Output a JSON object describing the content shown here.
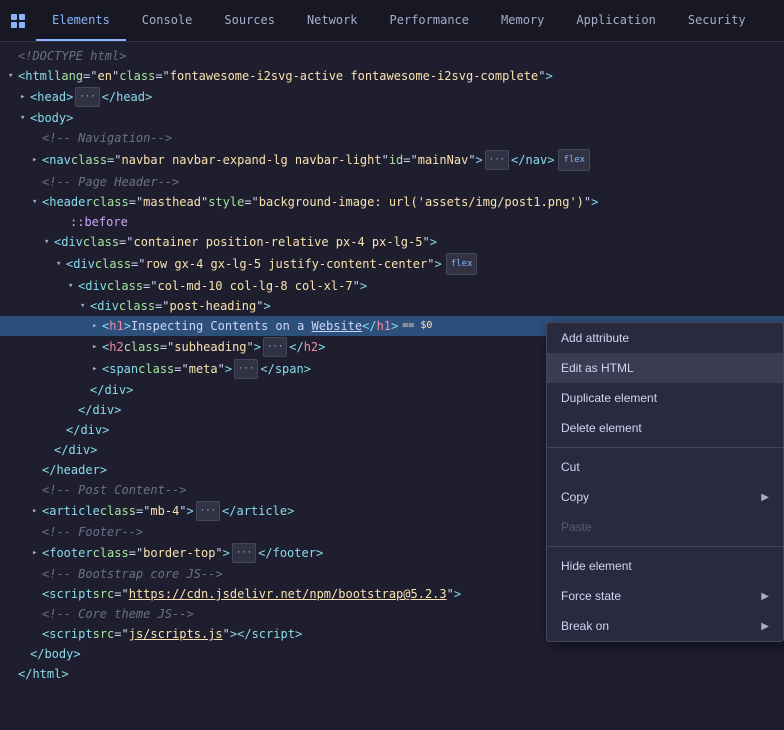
{
  "tabs": [
    {
      "id": "icon",
      "label": "⚙",
      "type": "icon"
    },
    {
      "id": "elements",
      "label": "Elements",
      "active": true
    },
    {
      "id": "console",
      "label": "Console"
    },
    {
      "id": "sources",
      "label": "Sources"
    },
    {
      "id": "network",
      "label": "Network"
    },
    {
      "id": "performance",
      "label": "Performance"
    },
    {
      "id": "memory",
      "label": "Memory"
    },
    {
      "id": "application",
      "label": "Application"
    },
    {
      "id": "security",
      "label": "Security"
    }
  ],
  "context_menu": {
    "items": [
      {
        "id": "add-attribute",
        "label": "Add attribute",
        "has_arrow": false,
        "disabled": false
      },
      {
        "id": "edit-as-html",
        "label": "Edit as HTML",
        "has_arrow": false,
        "disabled": false,
        "active": true
      },
      {
        "id": "duplicate-element",
        "label": "Duplicate element",
        "has_arrow": false,
        "disabled": false
      },
      {
        "id": "delete-element",
        "label": "Delete element",
        "has_arrow": false,
        "disabled": false
      },
      {
        "separator": true
      },
      {
        "id": "cut",
        "label": "Cut",
        "has_arrow": false,
        "disabled": false
      },
      {
        "id": "copy",
        "label": "Copy",
        "has_arrow": true,
        "disabled": false
      },
      {
        "id": "paste",
        "label": "Paste",
        "has_arrow": false,
        "disabled": true
      },
      {
        "separator": true
      },
      {
        "id": "hide-element",
        "label": "Hide element",
        "has_arrow": false,
        "disabled": false
      },
      {
        "id": "force-state",
        "label": "Force state",
        "has_arrow": true,
        "disabled": false
      },
      {
        "id": "break-on",
        "label": "Break on",
        "has_arrow": true,
        "disabled": false
      }
    ]
  }
}
